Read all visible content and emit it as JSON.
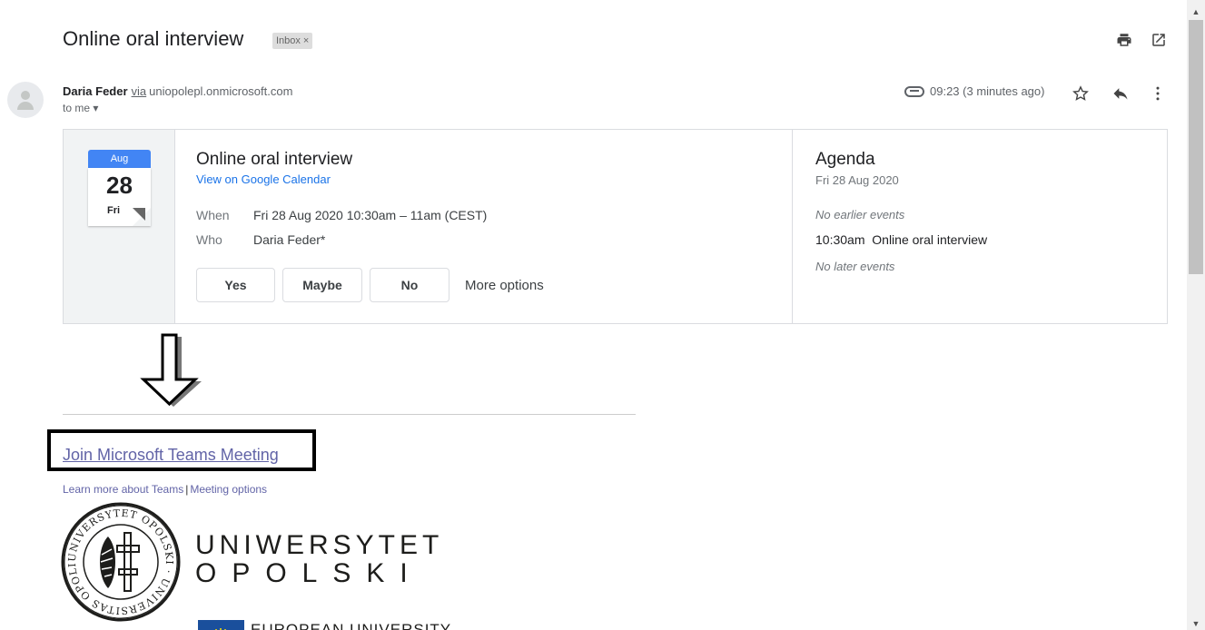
{
  "email": {
    "subject": "Online oral interview",
    "label_chip": "Inbox",
    "label_chip_close": "×",
    "sender_name": "Daria Feder",
    "via_text": "via",
    "via_domain": "uniopolepl.onmicrosoft.com",
    "recipient": "to me",
    "recipient_chevron": "▾",
    "timestamp": "09:23 (3 minutes ago)"
  },
  "toolbar_icons": [
    "print-icon",
    "open-in-new-window-icon",
    "attachment-icon",
    "star-icon",
    "reply-icon",
    "more-vert-icon"
  ],
  "event": {
    "month": "Aug",
    "day": "28",
    "weekday": "Fri",
    "title": "Online oral interview",
    "calendar_link": "View on Google Calendar",
    "when_label": "When",
    "when_value": "Fri 28 Aug 2020 10:30am – 11am (CEST)",
    "who_label": "Who",
    "who_value": "Daria Feder*",
    "rsvp": {
      "yes": "Yes",
      "maybe": "Maybe",
      "no": "No",
      "more": "More options"
    }
  },
  "agenda": {
    "title": "Agenda",
    "date": "Fri 28 Aug 2020",
    "earlier": "No earlier events",
    "event_time": "10:30am",
    "event_title": "Online oral interview",
    "later": "No later events"
  },
  "body": {
    "join_link": "Join Microsoft Teams Meeting",
    "learn_more": "Learn more about Teams",
    "separator": "|",
    "meeting_options": "Meeting options",
    "university_line1": "UNIWERSYTET",
    "university_line2": "OPOLSKI",
    "eu_text": "EUROPEAN UNIVERSITY",
    "seal_text": "UNIVERSYTET OPOLSKI · UNIVERSITAS OPOLIENSIS"
  },
  "colors": {
    "link_blue": "#1a73e8",
    "teams_purple": "#6264a7",
    "calendar_blue": "#4285f4"
  }
}
